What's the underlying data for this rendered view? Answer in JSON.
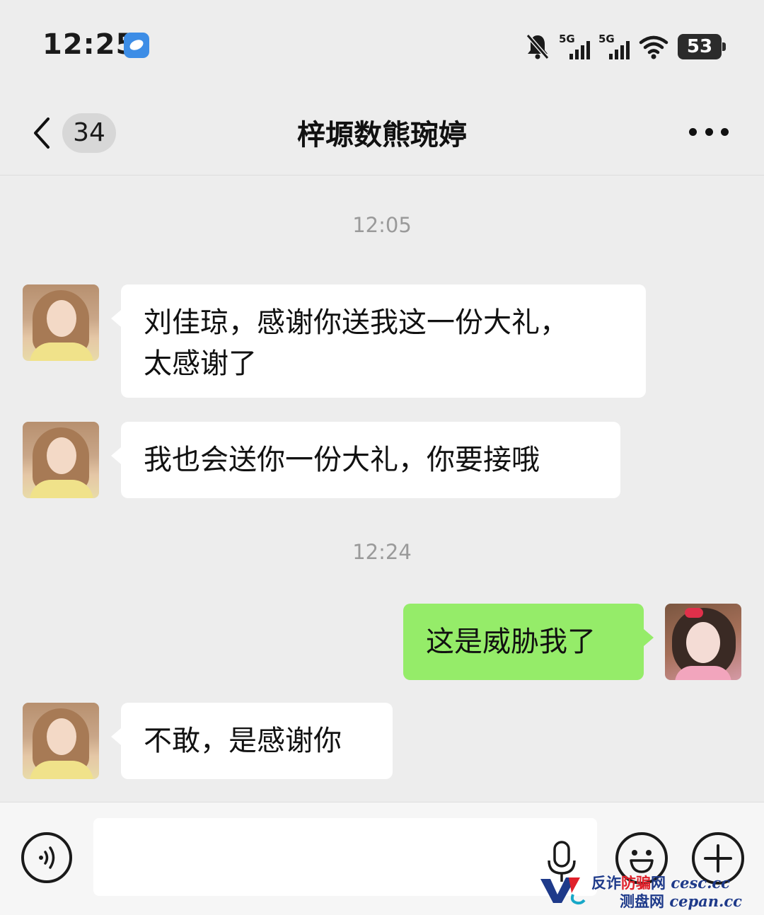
{
  "status_bar": {
    "time": "12:25",
    "network_1": "5G",
    "network_2": "5G",
    "battery": "53"
  },
  "nav": {
    "unread_count": "34",
    "title": "梓塬数熊琬婷"
  },
  "messages": [
    {
      "type": "timestamp",
      "text": "12:05"
    },
    {
      "type": "incoming",
      "line1": "刘佳琼，感谢你送我这一份大礼，",
      "line2": "太感谢了"
    },
    {
      "type": "incoming",
      "text": "我也会送你一份大礼，你要接哦"
    },
    {
      "type": "timestamp",
      "text": "12:24"
    },
    {
      "type": "outgoing",
      "text": "这是威胁我了"
    },
    {
      "type": "incoming",
      "text": "不敢，是感谢你"
    }
  ],
  "input": {
    "value": "",
    "placeholder": ""
  },
  "watermark": {
    "cn_part1": "反诈",
    "cn_part2": "防骗",
    "cn_part3": "网",
    "site1": "cesc.cc",
    "cn_line2": "测盘网",
    "site2": "cepan.cc"
  },
  "colors": {
    "background": "#ededed",
    "outgoing_bubble": "#95ec69",
    "incoming_bubble": "#ffffff",
    "timestamp_text": "#9a9a9a"
  }
}
